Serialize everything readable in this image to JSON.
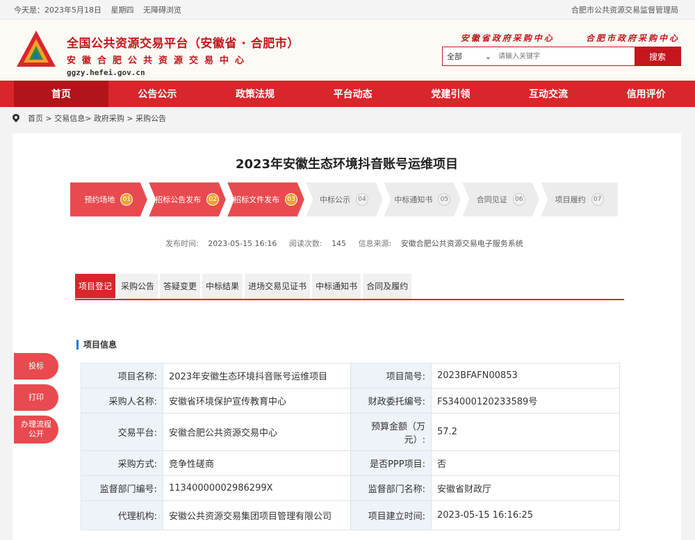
{
  "topbar": {
    "date": "今天是：2023年5月18日",
    "weekday": "星期四",
    "accessibility": "无障碍浏览",
    "right": "合肥市公共资源交易监督管理局"
  },
  "header": {
    "title": "全国公共资源交易平台（安徽省 · 合肥市）",
    "subtitle": "安徽合肥公共资源交易中心",
    "domain": "ggzy.hefei.gov.cn",
    "calligraphy_left": "安徽省政府采购中心",
    "calligraphy_right": "合肥市政府采购中心"
  },
  "search": {
    "select": "全部",
    "placeholder": "请输入关键字",
    "button": "搜索"
  },
  "nav": [
    "首页",
    "公告公示",
    "政策法规",
    "平台动态",
    "党建引领",
    "互动交流",
    "信用评价"
  ],
  "breadcrumb": "首页 > 交易信息> 政府采购 > 采购公告",
  "page_title": "2023年安徽生态环境抖音账号运维项目",
  "steps": [
    {
      "label": "预约场地",
      "num": "01",
      "done": true
    },
    {
      "label": "招标公告发布",
      "num": "02",
      "done": true
    },
    {
      "label": "招标文件发布",
      "num": "03",
      "done": true
    },
    {
      "label": "中标公示",
      "num": "04",
      "done": false
    },
    {
      "label": "中标通知书",
      "num": "05",
      "done": false
    },
    {
      "label": "合同见证",
      "num": "06",
      "done": false
    },
    {
      "label": "项目履约",
      "num": "07",
      "done": false
    }
  ],
  "meta": {
    "publish_label": "发布时间:",
    "publish_value": "2023-05-15 16:16",
    "views_label": "阅读次数:",
    "views_value": "145",
    "source_label": "信息来源:",
    "source_value": "安徽合肥公共资源交易电子服务系统"
  },
  "tabs": [
    "项目登记",
    "采购公告",
    "答疑变更",
    "中标结果",
    "进场交易见证书",
    "中标通知书",
    "合同及履约"
  ],
  "section_title": "项目信息",
  "info_rows": [
    {
      "k1": "项目名称:",
      "v1": "2023年安徽生态环境抖音账号运维项目",
      "k2": "项目简号:",
      "v2": "2023BFAFN00853"
    },
    {
      "k1": "采购人名称:",
      "v1": "安徽省环境保护宣传教育中心",
      "k2": "财政委托编号:",
      "v2": "FS34000120233589号"
    },
    {
      "k1": "交易平台:",
      "v1": "安徽合肥公共资源交易中心",
      "k2": "预算金额（万元）:",
      "v2": "57.2"
    },
    {
      "k1": "采购方式:",
      "v1": "竞争性磋商",
      "k2": "是否PPP项目:",
      "v2": "否"
    },
    {
      "k1": "监督部门编号:",
      "v1": "11340000002986299X",
      "k2": "监督部门名称:",
      "v2": "安徽省财政厅"
    },
    {
      "k1": "代理机构:",
      "v1": "安徽公共资源交易集团项目管理有限公司",
      "k2": "项目建立时间:",
      "v2": "2023-05-15 16:16:25"
    }
  ],
  "side_buttons": [
    "投标",
    "打印",
    "办理流程公开"
  ],
  "colors": {
    "brand_red": "#d8262b",
    "accent_orange": "#f6a02b",
    "label_bg": "#eef3f9"
  }
}
